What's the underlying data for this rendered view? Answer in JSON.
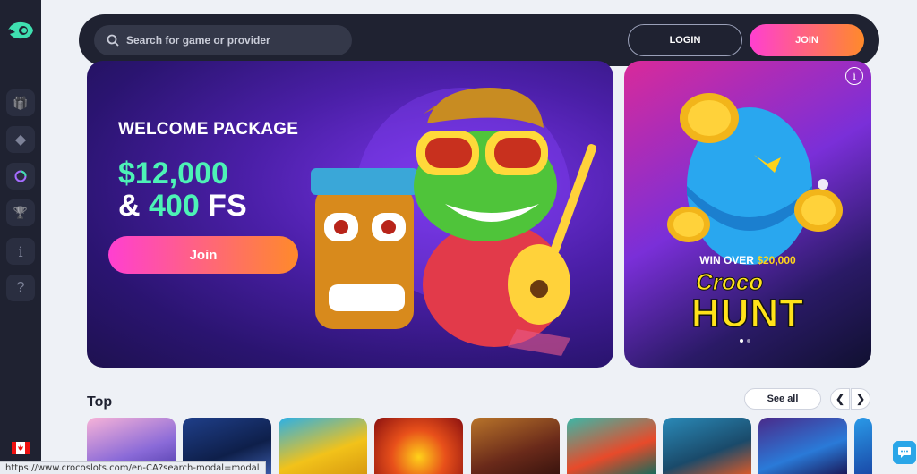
{
  "sidebar": {
    "items": [
      {
        "icon": "gift-icon",
        "glyph": "🎁"
      },
      {
        "icon": "diamond-icon",
        "glyph": "◆"
      },
      {
        "icon": "wheel-icon",
        "glyph": "◎"
      },
      {
        "icon": "trophy-icon",
        "glyph": "🏆"
      },
      {
        "icon": "info-icon",
        "glyph": "i"
      },
      {
        "icon": "help-icon",
        "glyph": "?"
      }
    ]
  },
  "header": {
    "search_placeholder": "Search for game or provider",
    "login_label": "LOGIN",
    "join_label": "JOIN"
  },
  "hero": {
    "title": "WELCOME PACKAGE",
    "amount_line1": "$12,000",
    "amount_line2_prefix": "& ",
    "amount_line2_value": "400",
    "amount_line2_suffix": " FS",
    "join_label": "Join"
  },
  "promo": {
    "win_over_prefix": "WIN OVER ",
    "win_over_value": "$20,000",
    "brand": "Croco",
    "title": "HUNT",
    "info_glyph": "i"
  },
  "top_section": {
    "title": "Top",
    "see_all_label": "See all",
    "prev_glyph": "❮",
    "next_glyph": "❯"
  },
  "status_bar": {
    "url": "https://www.crocoslots.com/en-CA?search-modal=modal"
  },
  "colors": {
    "accent_pink": "#ff3fd1",
    "accent_orange": "#ff8a2a",
    "accent_green": "#4df2b6",
    "sidebar_bg": "#1f2231"
  }
}
